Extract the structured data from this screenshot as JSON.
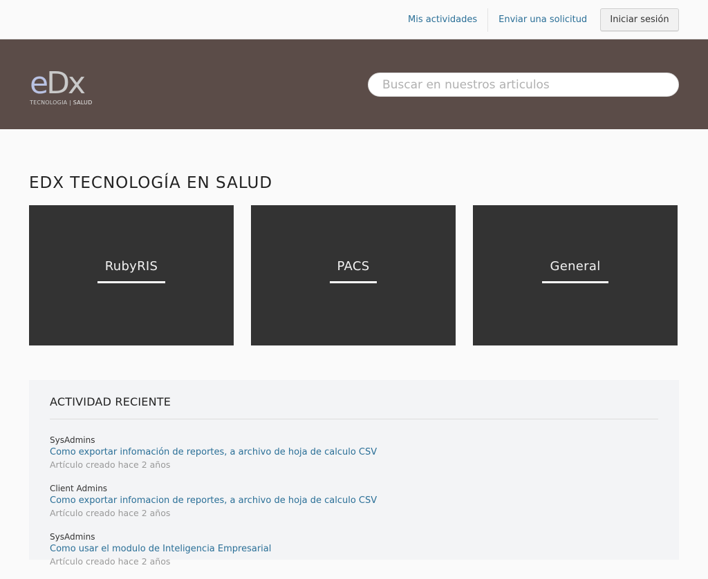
{
  "topnav": {
    "my_activities": "Mis actividades",
    "submit_request": "Enviar una solicitud",
    "login": "Iniciar sesión"
  },
  "logo": {
    "mark_e": "e",
    "mark_dx": "Dx",
    "tag_left": "TECNOLOGIA | ",
    "tag_right": "SALUD"
  },
  "search": {
    "placeholder": "Buscar en nuestros articulos"
  },
  "page_title": "EDX TECNOLOGÍA EN SALUD",
  "categories": [
    {
      "label": "RubyRIS"
    },
    {
      "label": "PACS"
    },
    {
      "label": "General"
    }
  ],
  "activity": {
    "heading": "ACTIVIDAD RECIENTE",
    "items": [
      {
        "section": "SysAdmins",
        "title": "Como exportar infomación de reportes, a archivo de hoja de calculo CSV",
        "meta": "Artículo creado hace 2 años"
      },
      {
        "section": "Client Admins",
        "title": "Como exportar infomacion de reportes, a archivo de hoja de calculo CSV",
        "meta": "Artículo creado hace 2 años"
      },
      {
        "section": "SysAdmins",
        "title": "Como usar el modulo de Inteligencia Empresarial",
        "meta": "Artículo creado hace 2 años"
      }
    ]
  },
  "colors": {
    "hero_bg": "#5b4c48",
    "tile_bg": "#333333",
    "link": "#2a6f97"
  }
}
